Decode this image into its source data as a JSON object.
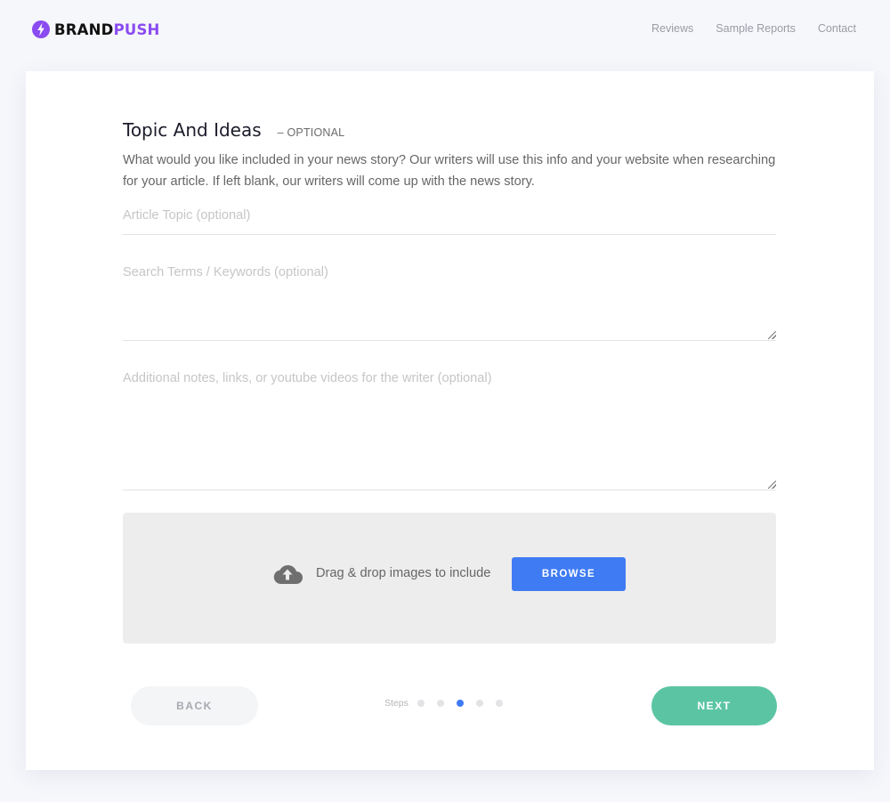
{
  "header": {
    "logo": {
      "icon": "bolt-icon",
      "part1": "BRAND",
      "part2": "PUSH",
      "accent": "#8a4cf0"
    },
    "nav": [
      "Reviews",
      "Sample Reports",
      "Contact"
    ]
  },
  "form": {
    "title": "Topic And Ideas",
    "optional_tag": "– OPTIONAL",
    "description": "What would you like included in your news story? Our writers will use this info and your website when researching for your article. If left blank, our writers will come up with the news story.",
    "fields": {
      "topic": {
        "value": "",
        "placeholder": "Article Topic (optional)"
      },
      "keywords": {
        "value": "",
        "placeholder": "Search Terms / Keywords (optional)"
      },
      "notes": {
        "value": "",
        "placeholder": "Additional notes, links, or youtube videos for the writer (optional)"
      }
    },
    "dropzone": {
      "icon": "cloud-upload-icon",
      "text": "Drag & drop images to include",
      "browse_label": "BROWSE",
      "browse_color": "#3f7bf3"
    }
  },
  "footer": {
    "back_label": "BACK",
    "next_label": "NEXT",
    "next_color": "#5bc5a3",
    "steps_label": "Steps",
    "steps_total": 5,
    "current_step": 3
  }
}
